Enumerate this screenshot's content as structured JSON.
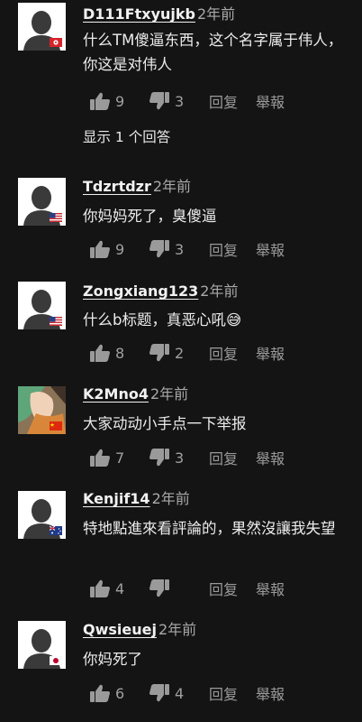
{
  "labels": {
    "reply": "回复",
    "report": "舉報",
    "show_replies": "显示 1 个回答"
  },
  "comments": [
    {
      "user": "D111Ftxyujkb",
      "time": "2年前",
      "text": "什么TM傻逼东西，这个名字属于伟人，你这是对伟人",
      "likes": "9",
      "dislikes": "3",
      "flag": "hk"
    },
    {
      "user": "Tdzrtdzr",
      "time": "2年前",
      "text": "你妈妈死了，臭傻逼",
      "likes": "9",
      "dislikes": "3",
      "flag": "us"
    },
    {
      "user": "Zongxiang123",
      "time": "2年前",
      "text": "什么b标题，真恶心吼😅",
      "likes": "8",
      "dislikes": "2",
      "flag": "us"
    },
    {
      "user": "K2Mno4",
      "time": "2年前",
      "text": "大家动动小手点一下举报",
      "likes": "7",
      "dislikes": "3",
      "flag": "cn"
    },
    {
      "user": "Kenjif14",
      "time": "2年前",
      "text": "特地點進來看評論的，果然沒讓我失望",
      "likes": "4",
      "dislikes": "",
      "flag": "au"
    },
    {
      "user": "Qwsieuej",
      "time": "2年前",
      "text": "你妈死了",
      "likes": "6",
      "dislikes": "4",
      "flag": "jp"
    }
  ]
}
